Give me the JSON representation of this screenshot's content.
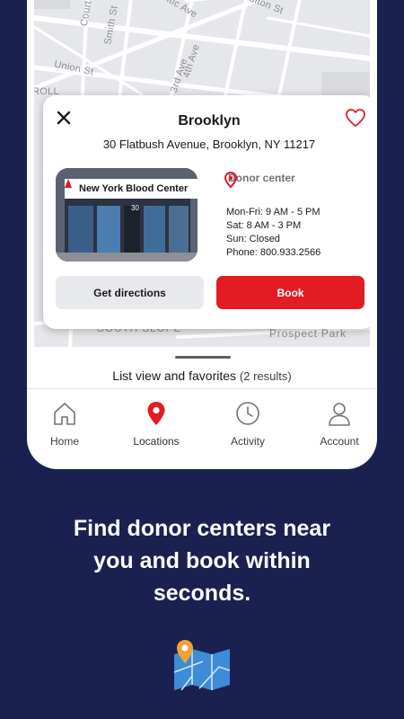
{
  "map": {
    "streets": [
      "Court St",
      "Smith St",
      "Atlantic Ave",
      "Fulton St",
      "Union St",
      "3rd Ave",
      "4th Ave",
      "ROLL"
    ],
    "areas": [
      "SOUTH SLOPE",
      "Prospect Park"
    ]
  },
  "card": {
    "close_icon": "close-icon",
    "favorite_icon": "heart-icon",
    "title": "Brooklyn",
    "address": "30 Flatbush Avenue, Brooklyn, NY 11217",
    "photo_sign": "New York Blood Center",
    "photo_number": "30",
    "type_icon": "location-pin-icon",
    "type": "Donor center",
    "hours": [
      "Mon-Fri: 9 AM - 5 PM",
      "Sat: 8 AM - 3 PM",
      "Sun: Closed",
      "Phone: 800.933.2566"
    ],
    "directions_label": "Get directions",
    "book_label": "Book"
  },
  "list": {
    "label": "List view and favorites",
    "count": "(2 results)"
  },
  "nav": {
    "tabs": [
      {
        "label": "Home",
        "icon": "home-icon"
      },
      {
        "label": "Locations",
        "icon": "location-pin-icon",
        "active": true
      },
      {
        "label": "Activity",
        "icon": "clock-icon"
      },
      {
        "label": "Account",
        "icon": "person-icon"
      }
    ]
  },
  "promo": {
    "lines": [
      "Find donor centers near",
      "you and book within",
      "seconds."
    ],
    "icon": "map-pin-icon"
  },
  "colors": {
    "background": "#1a2050",
    "accent": "#e31b23",
    "map": "#e6e7ea"
  }
}
